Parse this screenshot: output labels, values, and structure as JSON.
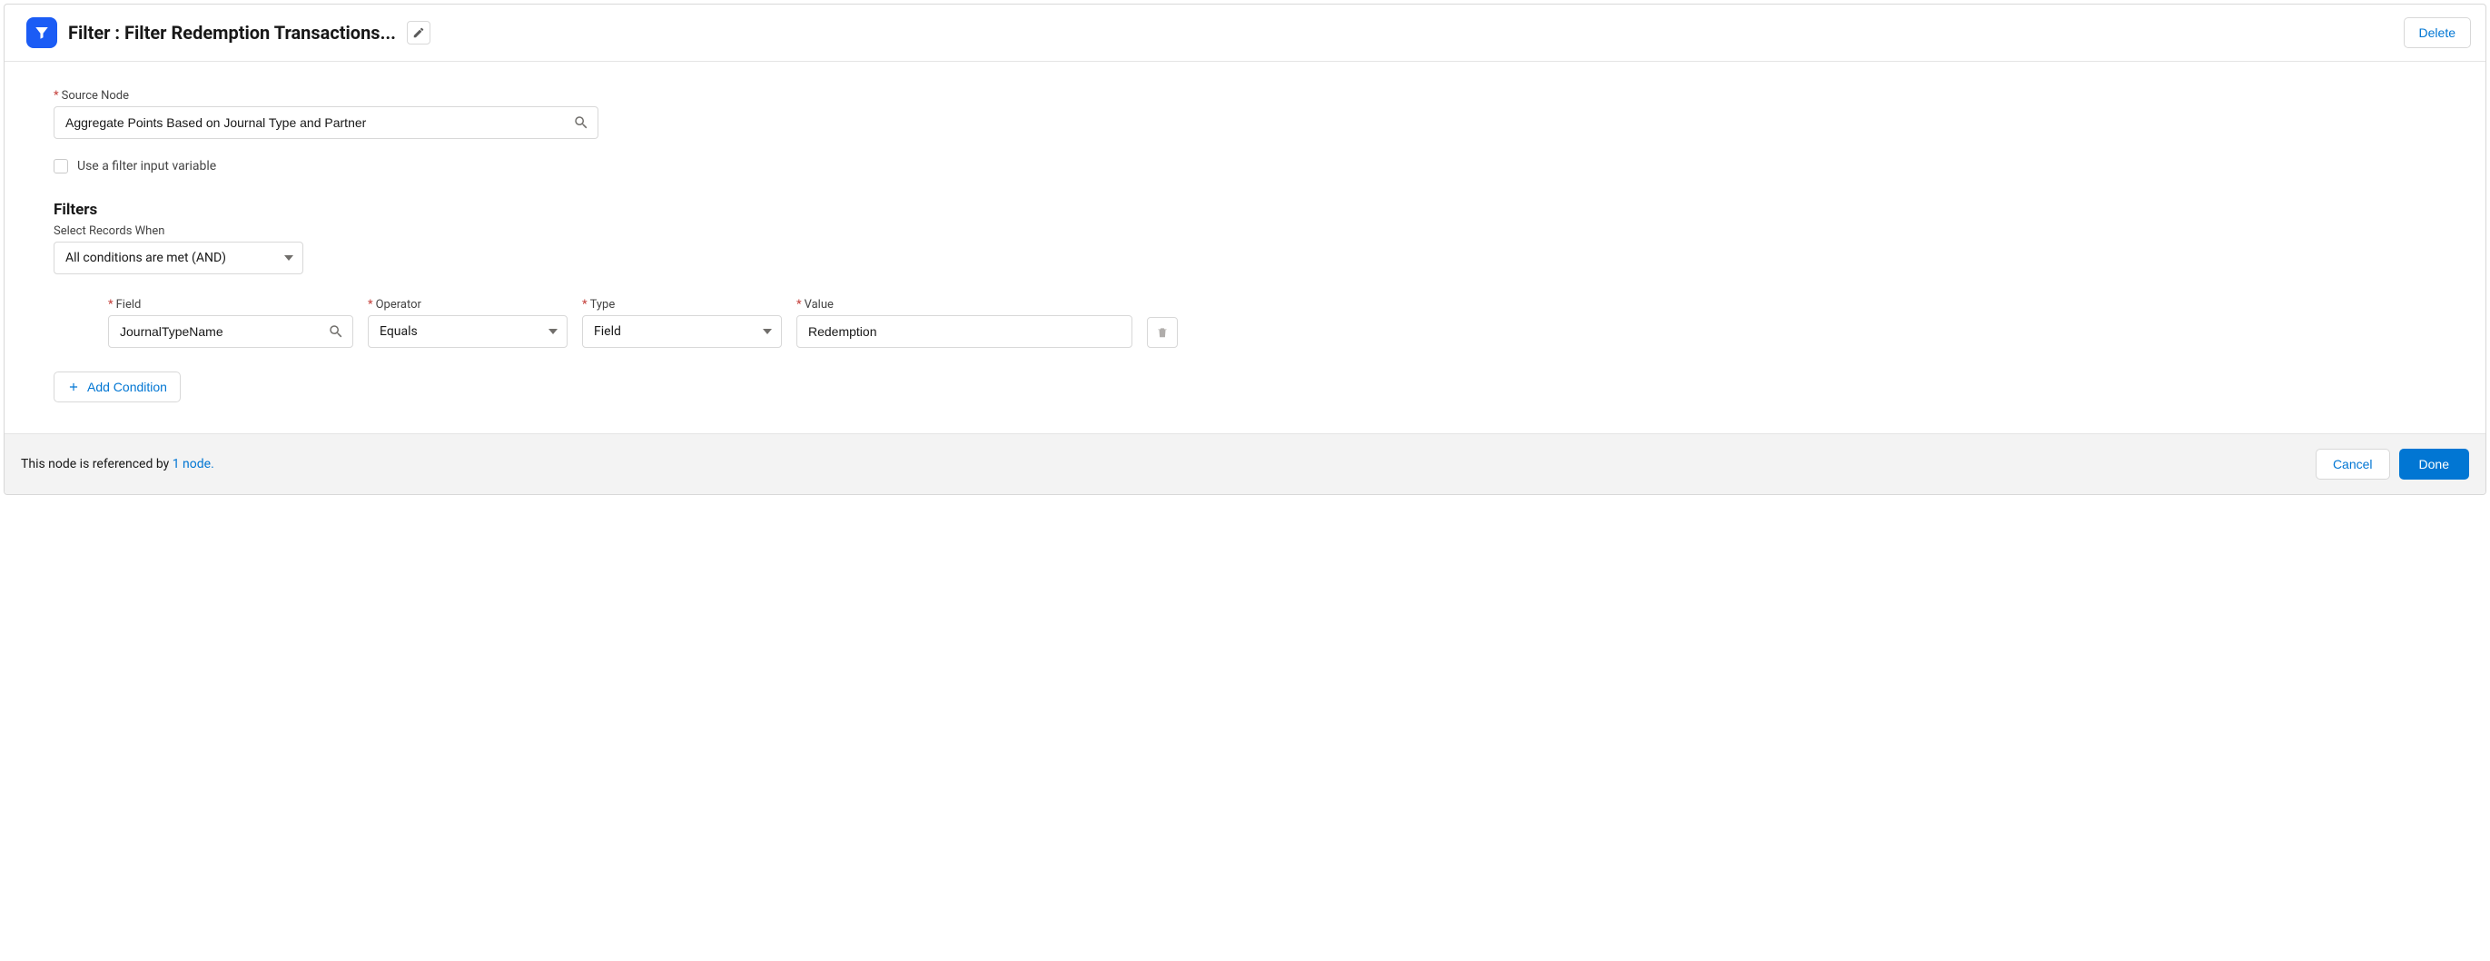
{
  "header": {
    "title_prefix": "Filter :  ",
    "title_name": "Filter Redemption Transactions...",
    "delete_label": "Delete"
  },
  "source": {
    "label": "Source Node",
    "value": "Aggregate Points Based on Journal Type and Partner"
  },
  "filter_variable": {
    "label": "Use a filter input variable",
    "checked": false
  },
  "filters": {
    "section_title": "Filters",
    "select_records_label": "Select Records When",
    "logic_value": "All conditions are met (AND)"
  },
  "condition": {
    "field_label": "Field",
    "field_value": "JournalTypeName",
    "operator_label": "Operator",
    "operator_value": "Equals",
    "type_label": "Type",
    "type_value": "Field",
    "value_label": "Value",
    "value_value": "Redemption"
  },
  "add_condition_label": "Add Condition",
  "footer": {
    "ref_prefix": "This node is referenced by ",
    "ref_link": "1 node.",
    "cancel_label": "Cancel",
    "done_label": "Done"
  }
}
